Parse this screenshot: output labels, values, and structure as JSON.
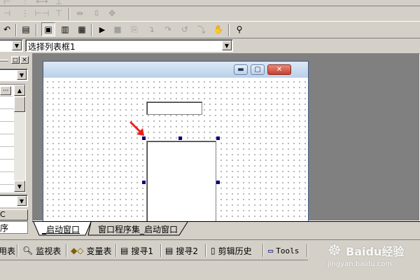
{
  "toolbar": {
    "combo_left": {
      "value": ""
    },
    "combo_main": {
      "value": "选择列表框1"
    }
  },
  "properties_panel": {
    "combo_value": "",
    "partial_label_1": "C",
    "partial_label_2": "序"
  },
  "designer": {
    "window_controls": {
      "minimize": "minimize-icon",
      "maximize": "maximize-icon",
      "close": "close-icon"
    },
    "textbox_value": "",
    "listbox_items": []
  },
  "tabs": [
    {
      "label": "_启动窗口"
    },
    {
      "label": "窗口程序集_启动窗口"
    }
  ],
  "bottom_tabs": [
    {
      "label": "用表"
    },
    {
      "label": "监视表"
    },
    {
      "label": "变量表"
    },
    {
      "label": "搜寻1"
    },
    {
      "label": "搜寻2"
    },
    {
      "label": "剪辑历史"
    },
    {
      "label": "Tools"
    }
  ],
  "watermark": {
    "brand": "Baidu经验",
    "url": "jingyan.baidu.com"
  },
  "colors": {
    "accent_red": "#e8201a",
    "handle_blue": "#000080",
    "window_title": "#cfe0f3"
  }
}
